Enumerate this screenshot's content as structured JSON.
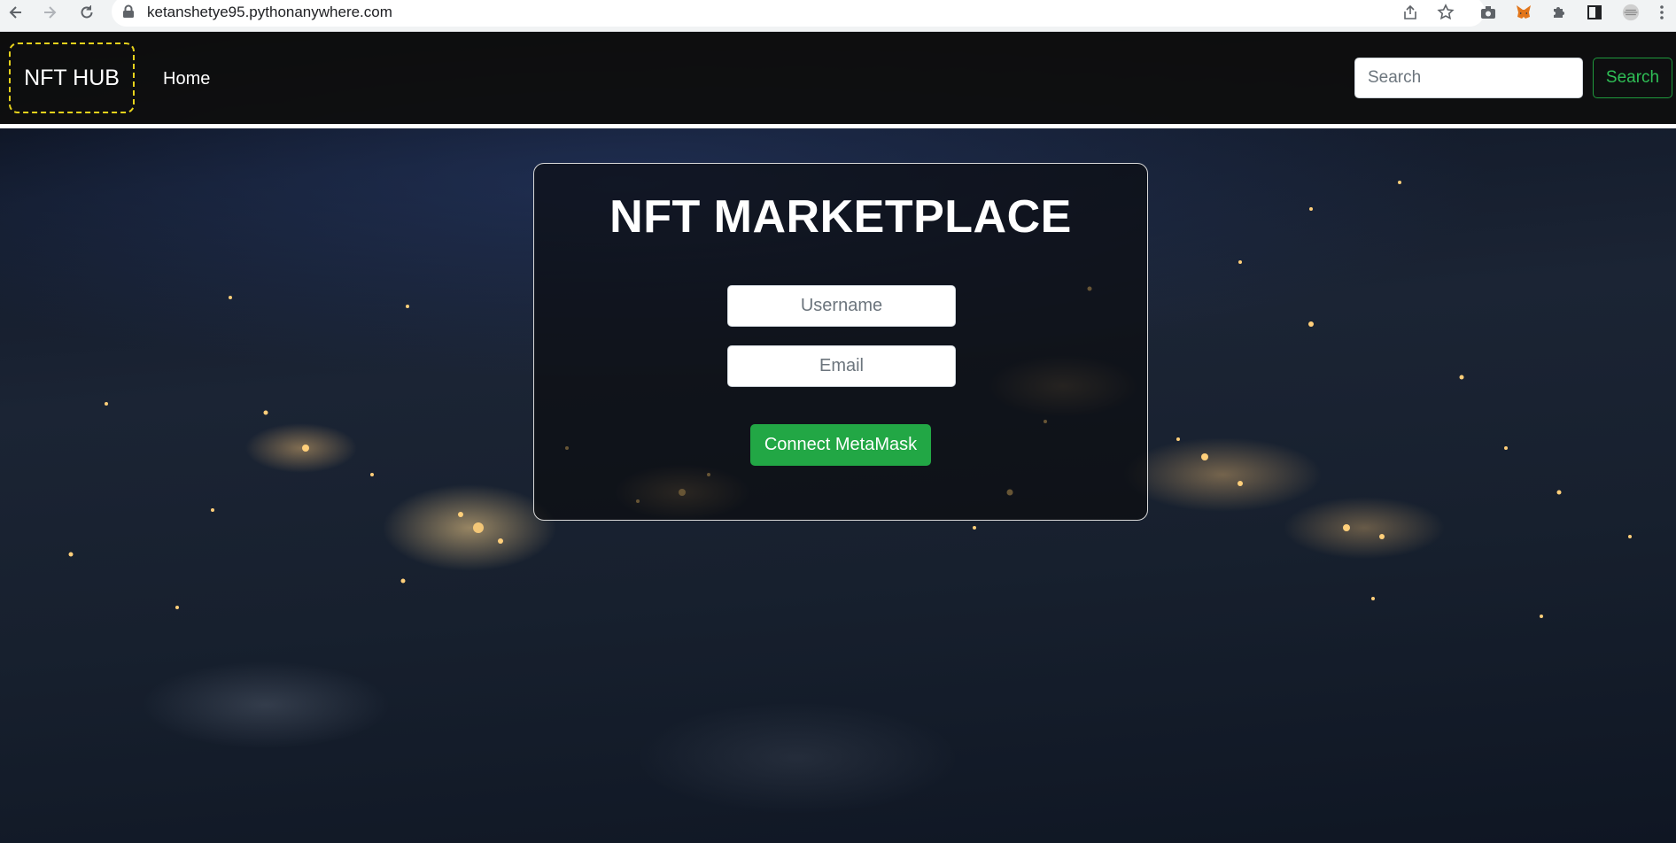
{
  "browser": {
    "url": "ketanshetye95.pythonanywhere.com",
    "icons": [
      "back-icon",
      "forward-icon",
      "reload-icon",
      "lock-icon",
      "share-icon",
      "star-icon",
      "camera-icon",
      "metamask-fox-icon",
      "puzzle-icon",
      "side-panel-icon",
      "profile-avatar",
      "kebab-menu-icon"
    ]
  },
  "navbar": {
    "brand": "NFT HUB",
    "home_link": "Home",
    "search_placeholder": "Search",
    "search_button": "Search",
    "colors": {
      "brand_border": "#e7d21c",
      "search_button": "#2fbf56"
    }
  },
  "login_card": {
    "title": "NFT MARKETPLACE",
    "username_placeholder": "Username",
    "email_placeholder": "Email",
    "connect_button": "Connect MetaMask",
    "colors": {
      "connect_button": "#22a745"
    }
  }
}
